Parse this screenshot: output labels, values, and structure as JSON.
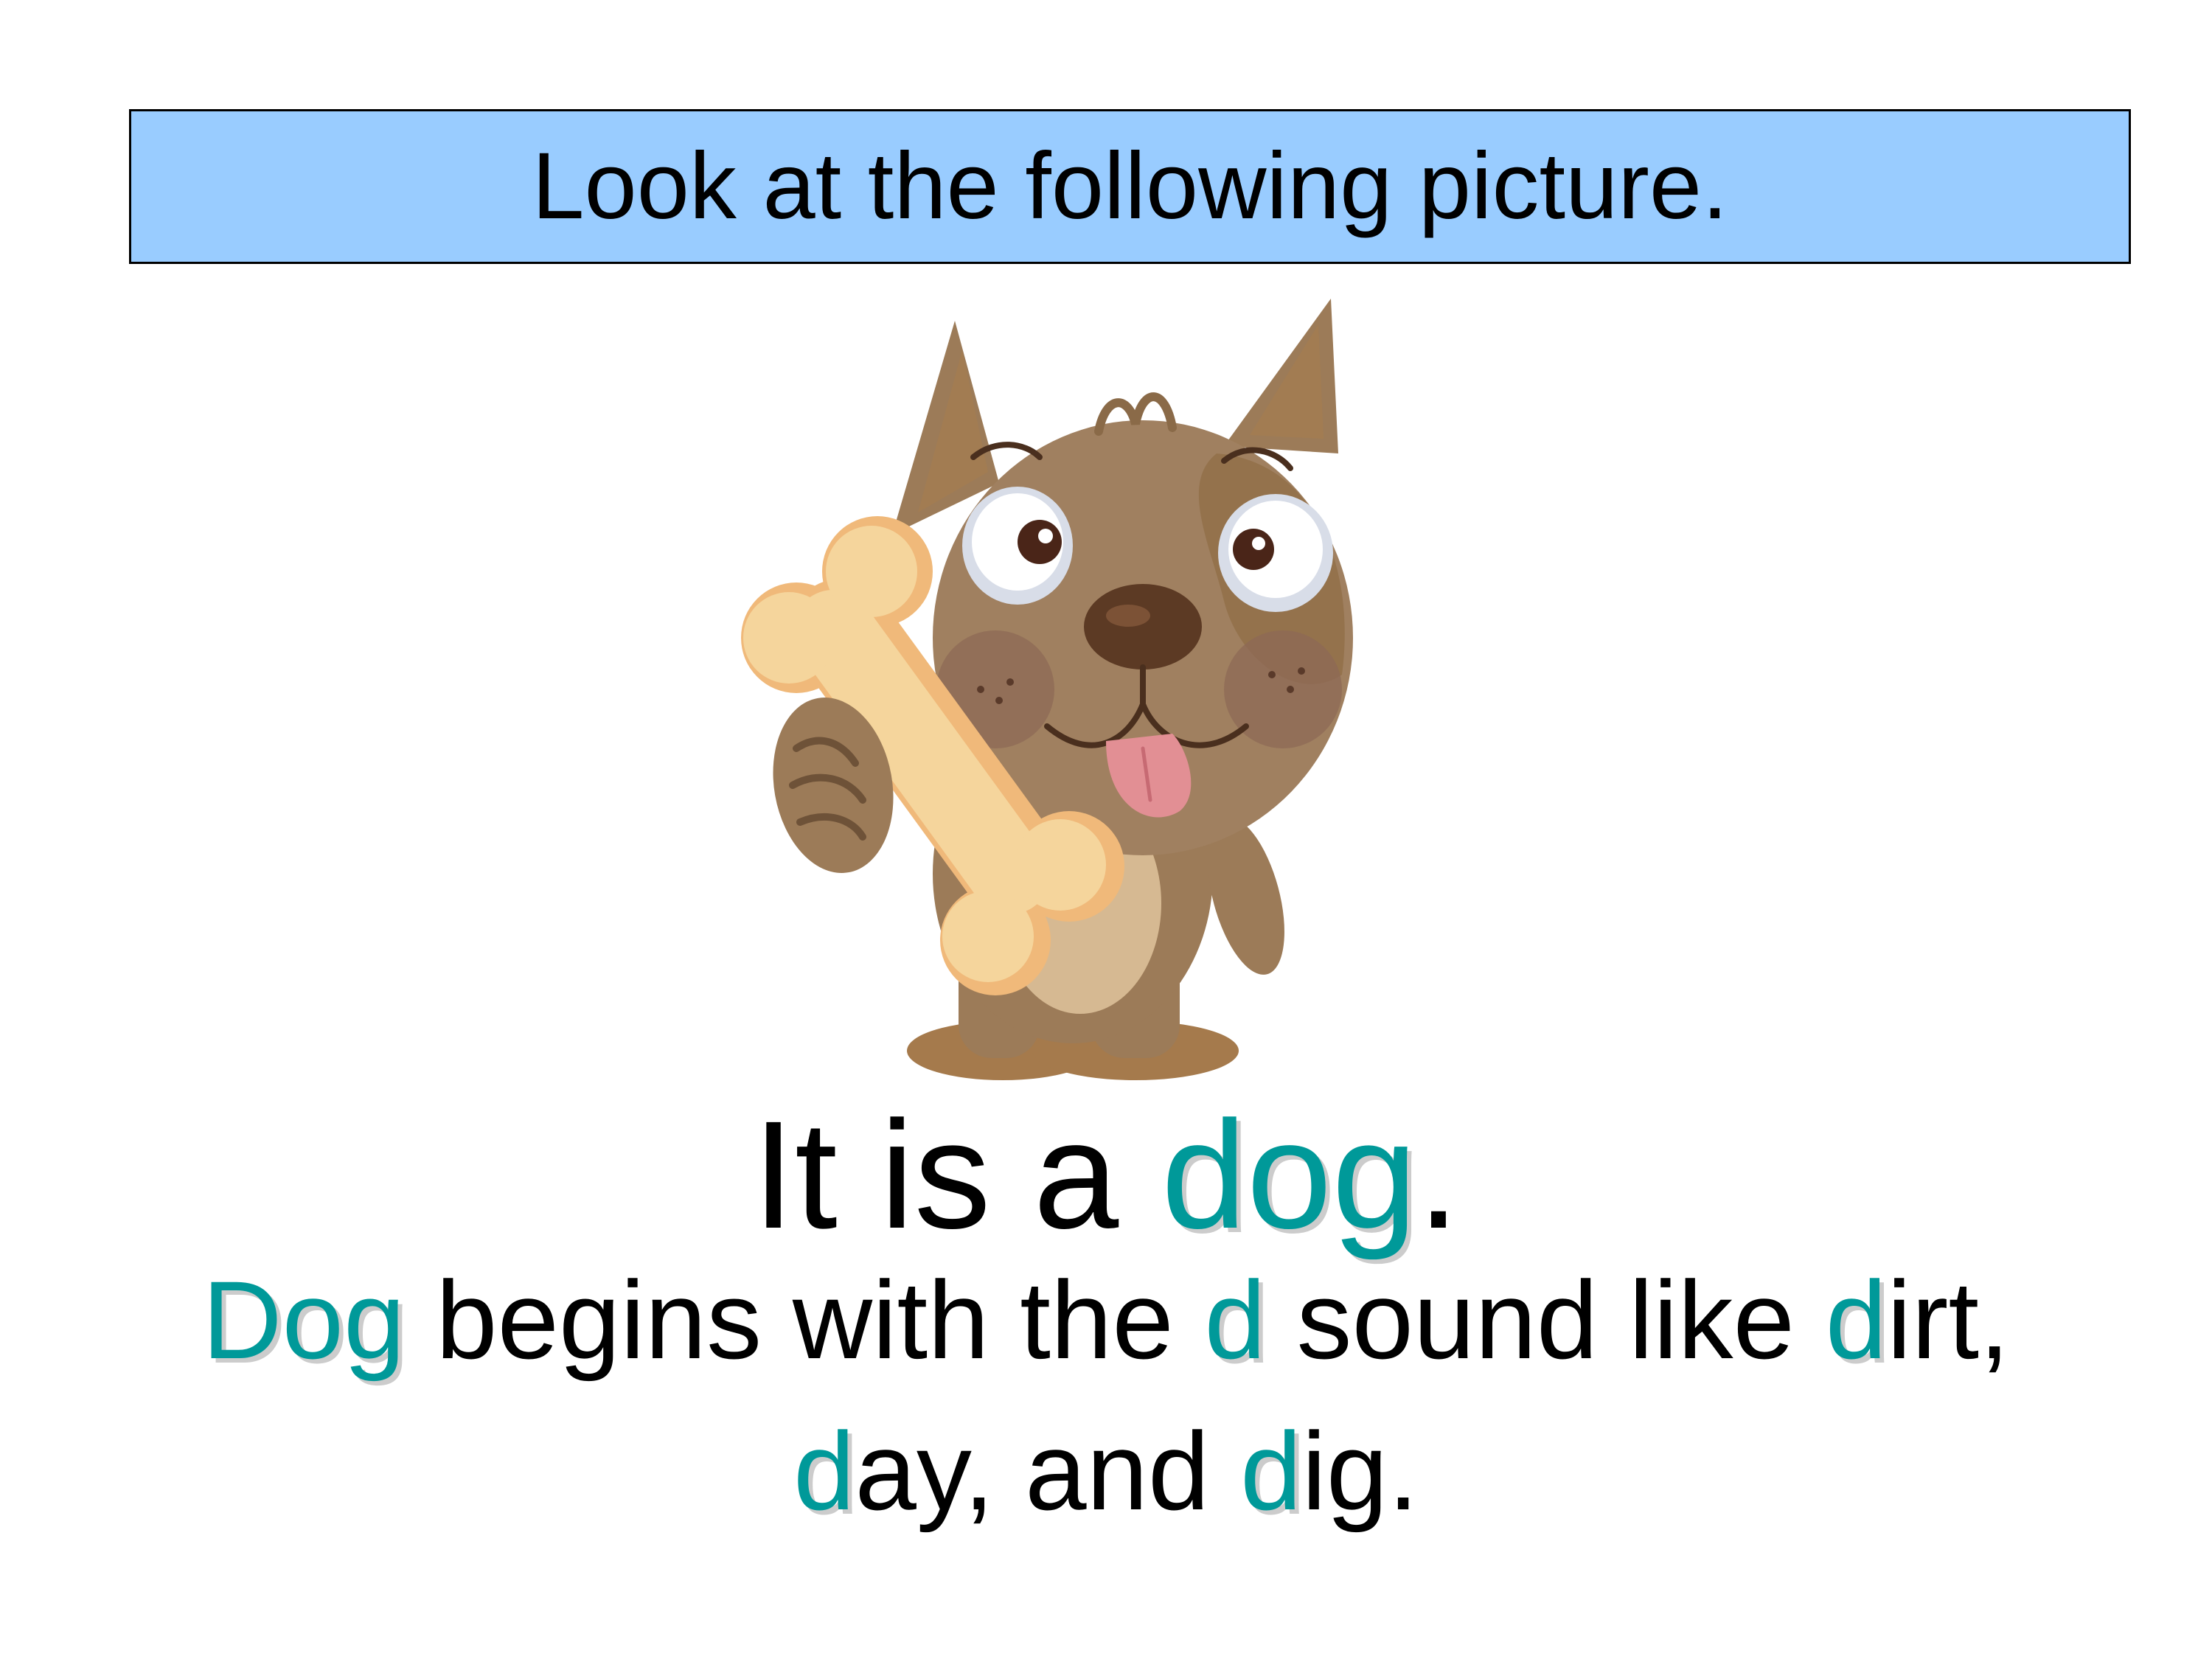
{
  "slide": {
    "title": "Look at the following picture.",
    "sentence": {
      "prefix": "It is a ",
      "keyword": "dog",
      "suffix": "."
    },
    "phonics_line1": {
      "word": "Dog",
      "part1": " begins with the ",
      "letter": "d",
      "part2": " sound like ",
      "ex1_letter": "d",
      "ex1_rest": "irt,"
    },
    "phonics_line2": {
      "ex2_letter": "d",
      "ex2_rest": "ay, and ",
      "ex3_letter": "d",
      "ex3_rest": "ig."
    }
  },
  "colors": {
    "title_bg": "#99ccff",
    "highlight": "#009999",
    "text": "#000000"
  },
  "illustration": {
    "icon": "cartoon-dog-holding-bone"
  }
}
